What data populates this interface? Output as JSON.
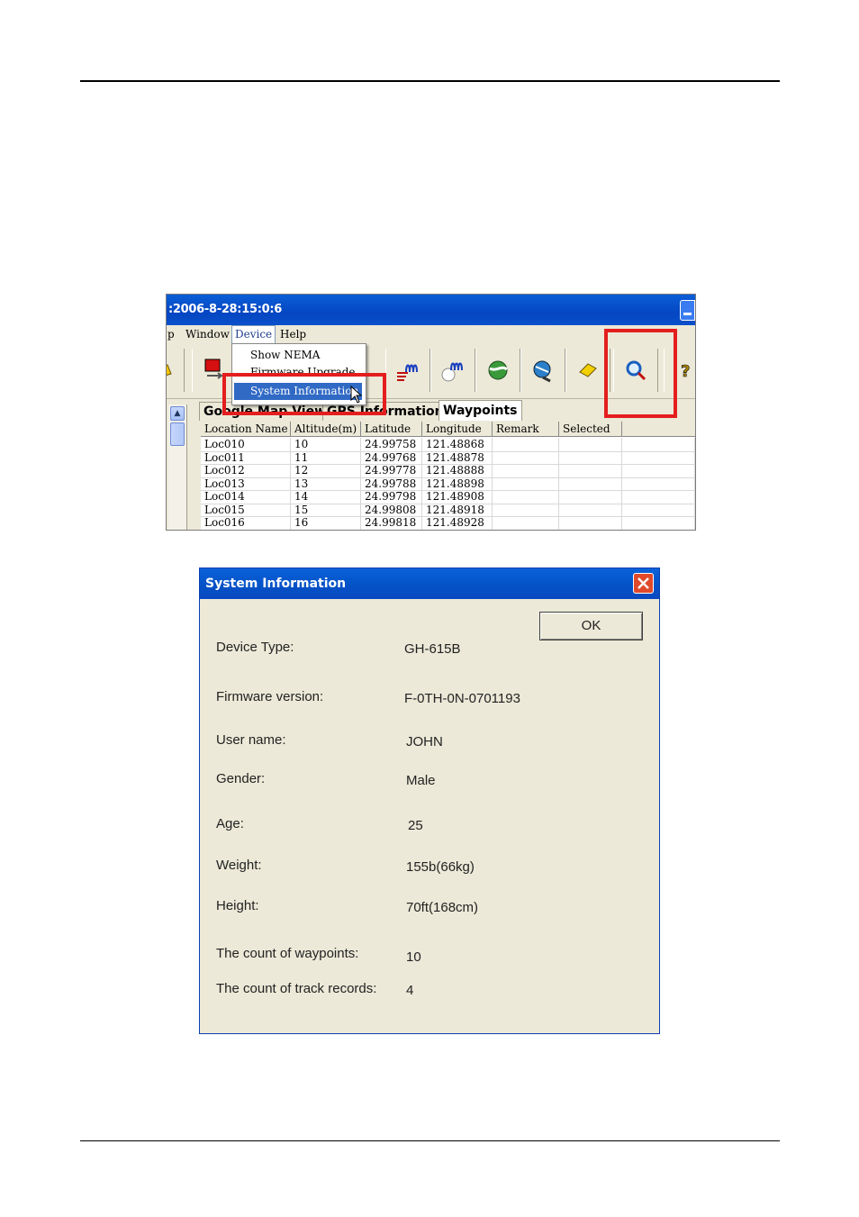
{
  "app": {
    "title": ":2006-8-28:15:0:6",
    "menu": [
      "p",
      "Window",
      "Device",
      "Help"
    ],
    "device_menu": [
      "Show NEMA",
      "Firmware Upgrade",
      "System Information"
    ],
    "tabs": [
      "Google Map View",
      "GPS Information",
      "Waypoints"
    ],
    "columns": [
      "Location Name",
      "Altitude(m)",
      "Latitude",
      "Longitude",
      "Remark",
      "Selected"
    ],
    "rows": [
      [
        "Loc010",
        "10",
        "24.99758",
        "121.48868"
      ],
      [
        "Loc011",
        "11",
        "24.99768",
        "121.48878"
      ],
      [
        "Loc012",
        "12",
        "24.99778",
        "121.48888"
      ],
      [
        "Loc013",
        "13",
        "24.99788",
        "121.48898"
      ],
      [
        "Loc014",
        "14",
        "24.99798",
        "121.48908"
      ],
      [
        "Loc015",
        "15",
        "24.99808",
        "121.48918"
      ],
      [
        "Loc016",
        "16",
        "24.99818",
        "121.48928"
      ]
    ],
    "highlight_color": "#e41e1e",
    "selection_color": "#316ac5"
  },
  "dialog": {
    "title": "System Information",
    "ok_label": "OK",
    "fields": [
      {
        "label": "Device Type:",
        "value": "GH-615B"
      },
      {
        "label": "Firmware version:",
        "value": "F-0TH-0N-0701193"
      },
      {
        "label": "User name:",
        "value": "JOHN"
      },
      {
        "label": "Gender:",
        "value": "Male"
      },
      {
        "label": "Age:",
        "value": "25"
      },
      {
        "label": "Weight:",
        "value": "155b(66kg)"
      },
      {
        "label": "Height:",
        "value": "70ft(168cm)"
      },
      {
        "label": "The count of waypoints:",
        "value": "10"
      },
      {
        "label": "The count of track records:",
        "value": "4"
      }
    ]
  }
}
